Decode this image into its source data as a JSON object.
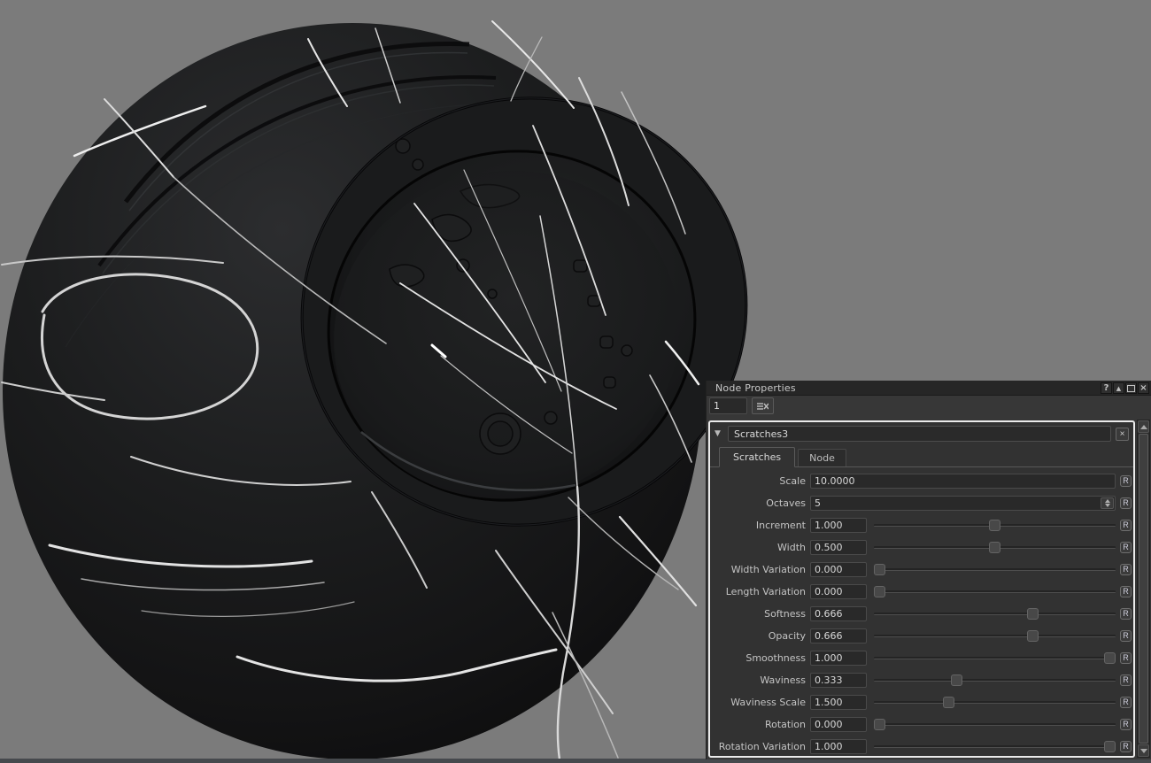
{
  "colors": {
    "background": "#7b7b7b",
    "panel": "#373737",
    "titlebar": "#262626",
    "focus_border": "#ebebeb",
    "field": "#292929",
    "bottom_strip": "#46494d"
  },
  "panel": {
    "title": "Node Properties",
    "titlebar_icons": {
      "help": "?",
      "float": "▲",
      "close": "×"
    },
    "panel_count_value": "1",
    "node": {
      "collapse_glyph": "▼",
      "name": "Scratches3",
      "close_glyph": "×",
      "tabs": [
        {
          "label": "Scratches"
        },
        {
          "label": "Node"
        }
      ],
      "reset_label": "R",
      "params": [
        {
          "label": "Scale",
          "value": "10.0000",
          "control": "text"
        },
        {
          "label": "Octaves",
          "value": "5",
          "control": "spin"
        },
        {
          "label": "Increment",
          "value": "1.000",
          "control": "slider",
          "fraction": 0.5
        },
        {
          "label": "Width",
          "value": "0.500",
          "control": "slider",
          "fraction": 0.5
        },
        {
          "label": "Width Variation",
          "value": "0.000",
          "control": "slider",
          "fraction": 0.0
        },
        {
          "label": "Length Variation",
          "value": "0.000",
          "control": "slider",
          "fraction": 0.0
        },
        {
          "label": "Softness",
          "value": "0.666",
          "control": "slider",
          "fraction": 0.666
        },
        {
          "label": "Opacity",
          "value": "0.666",
          "control": "slider",
          "fraction": 0.666
        },
        {
          "label": "Smoothness",
          "value": "1.000",
          "control": "slider",
          "fraction": 1.0
        },
        {
          "label": "Waviness",
          "value": "0.333",
          "control": "slider",
          "fraction": 0.333
        },
        {
          "label": "Waviness Scale",
          "value": "1.500",
          "control": "slider",
          "fraction": 0.3
        },
        {
          "label": "Rotation",
          "value": "0.000",
          "control": "slider",
          "fraction": 0.0
        },
        {
          "label": "Rotation Variation",
          "value": "1.000",
          "control": "slider",
          "fraction": 1.0
        }
      ]
    }
  }
}
